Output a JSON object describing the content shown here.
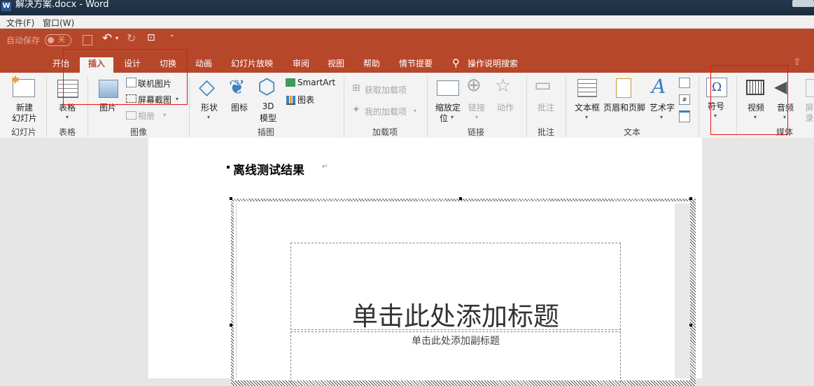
{
  "window": {
    "title": "解决方案.docx - Word",
    "app_icon": "W"
  },
  "menubar": {
    "items": [
      "文件(F)",
      "窗口(W)"
    ]
  },
  "qat": {
    "autosave_label": "自动保存",
    "toggle_state": "关"
  },
  "tabs": [
    "开始",
    "插入",
    "设计",
    "切换",
    "动画",
    "幻灯片放映",
    "审阅",
    "视图",
    "帮助",
    "情节提要"
  ],
  "active_tab": "插入",
  "tell_me": "操作说明搜索",
  "ribbon": {
    "groups": {
      "slides": "幻灯片",
      "tables": "表格",
      "images": "图像",
      "illustrations": "插图",
      "addins": "加载项",
      "links": "链接",
      "comments": "批注",
      "text": "文本",
      "media": "媒体"
    },
    "buttons": {
      "new_slide_1": "新建",
      "new_slide_2": "幻灯片",
      "table": "表格",
      "picture": "图片",
      "online_pictures": "联机图片",
      "screenshot": "屏幕截图",
      "album": "相册",
      "shapes": "形状",
      "icons": "图标",
      "model3d_1": "3D",
      "model3d_2": "模型",
      "smartart": "SmartArt",
      "chart": "图表",
      "get_addins": "获取加载项",
      "my_addins": "我的加载项",
      "zoom_1": "缩放定",
      "zoom_2": "位",
      "link": "链接",
      "action": "动作",
      "comment": "批注",
      "textbox": "文本框",
      "header_footer": "页眉和页脚",
      "wordart": "艺术字",
      "symbol": "符号",
      "video": "视频",
      "audio": "音频",
      "screen_rec_1": "屏",
      "screen_rec_2": "录"
    }
  },
  "document": {
    "heading": "离线测试结果",
    "slide_title": "单击此处添加标题",
    "slide_subtitle": "单击此处添加副标题"
  },
  "colors": {
    "accent": "#b7472a",
    "highlight": "#ee1111"
  }
}
